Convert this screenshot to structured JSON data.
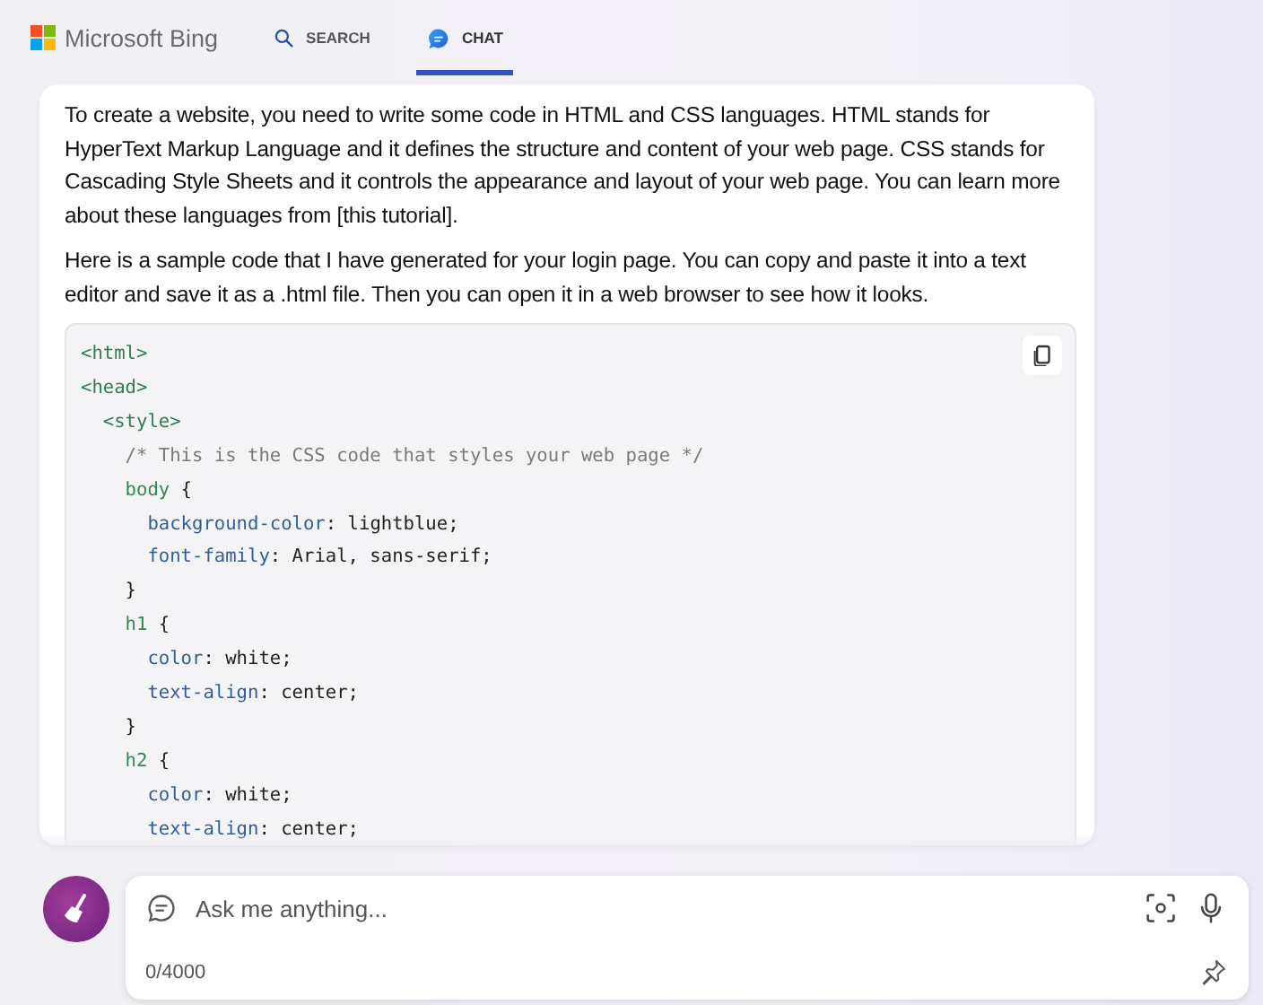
{
  "header": {
    "logo": "Microsoft Bing",
    "tabs": [
      {
        "label": "SEARCH",
        "kind": "search",
        "selected": false
      },
      {
        "label": "CHAT",
        "kind": "chat",
        "selected": true
      }
    ]
  },
  "message": {
    "paragraphs": [
      "To create a website, you need to write some code in HTML and CSS languages. HTML stands for HyperText Markup Language and it defines the structure and content of your web page. CSS stands for Cascading Style Sheets and it controls the appearance and layout of your web page. You can learn more about these languages from [this tutorial].",
      "Here is a sample code that I have generated for your login page. You can copy and paste it into a text editor and save it as a .html file. Then you can open it in a web browser to see how it looks."
    ],
    "code": [
      [
        {
          "kind": "tag",
          "text": "<html>"
        }
      ],
      [
        {
          "kind": "tag",
          "text": "<head>"
        }
      ],
      [
        {
          "kind": "tag",
          "text": "  <style>"
        }
      ],
      [
        {
          "kind": "comment",
          "text": "    /* This is the CSS code that styles your web page */"
        }
      ],
      [
        {
          "kind": "selector",
          "text": "    body"
        },
        {
          "kind": "plain",
          "text": " {"
        }
      ],
      [
        {
          "kind": "prop",
          "text": "      background-color"
        },
        {
          "kind": "plain",
          "text": ": lightblue;"
        }
      ],
      [
        {
          "kind": "prop",
          "text": "      font-family"
        },
        {
          "kind": "plain",
          "text": ": Arial, sans-serif;"
        }
      ],
      [
        {
          "kind": "plain",
          "text": "    }"
        }
      ],
      [
        {
          "kind": "selector",
          "text": "    h1"
        },
        {
          "kind": "plain",
          "text": " {"
        }
      ],
      [
        {
          "kind": "prop",
          "text": "      color"
        },
        {
          "kind": "plain",
          "text": ": white;"
        }
      ],
      [
        {
          "kind": "prop",
          "text": "      text-align"
        },
        {
          "kind": "plain",
          "text": ": center;"
        }
      ],
      [
        {
          "kind": "plain",
          "text": "    }"
        }
      ],
      [
        {
          "kind": "selector",
          "text": "    h2"
        },
        {
          "kind": "plain",
          "text": " {"
        }
      ],
      [
        {
          "kind": "prop",
          "text": "      color"
        },
        {
          "kind": "plain",
          "text": ": white;"
        }
      ],
      [
        {
          "kind": "prop",
          "text": "      text-align"
        },
        {
          "kind": "plain",
          "text": ": center;"
        }
      ]
    ]
  },
  "composer": {
    "placeholder": "Ask me anything...",
    "counter": "0/4000"
  }
}
